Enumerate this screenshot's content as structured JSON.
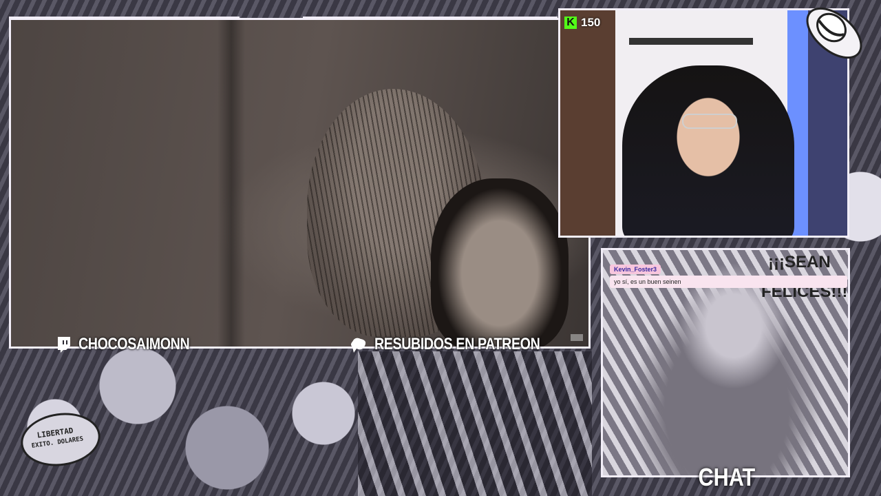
{
  "stream": {
    "kick_viewers": "150",
    "twitch_handle": "CHOCOSAIMONN",
    "patreon_text": "RESUBIDOS EN PATREON",
    "chat_title": "CHAT"
  },
  "chat": {
    "messages": [
      {
        "user": "Kevin_Foster3",
        "text": "yo sí, es un buen seinen"
      }
    ]
  },
  "background": {
    "badge_text": [
      "LIBERTAD",
      "EXITO. DOLARES"
    ],
    "banner_text": [
      "¡¡¡SEAN",
      "FELICES!!!"
    ]
  },
  "colors": {
    "frame": "#f2eef8",
    "kick": "#53fc18",
    "chat_user_bg": "#f7c6dd",
    "chat_msg_bg": "#f9e4ef"
  }
}
